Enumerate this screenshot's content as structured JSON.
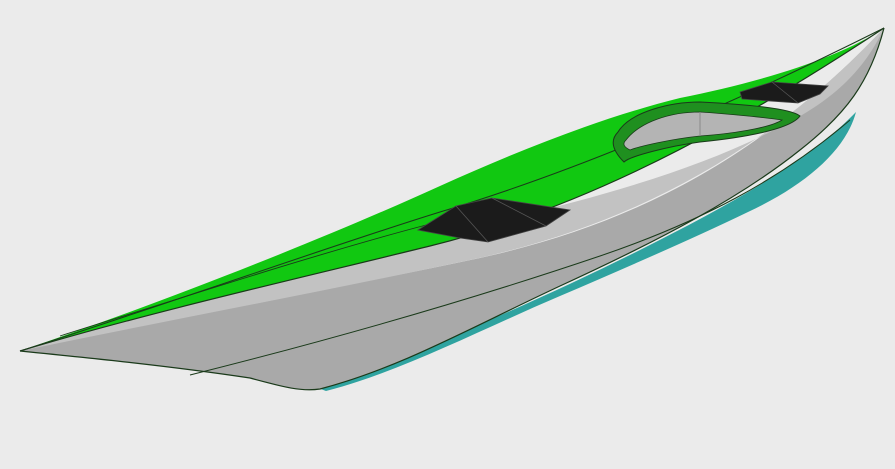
{
  "scene": {
    "subject": "kayak-3d-model",
    "background_color": "#ebebeb",
    "colors": {
      "deck": "#11c811",
      "deck_dark": "#0aa50a",
      "hull": "#a9a9a9",
      "hull_light": "#c2c2c2",
      "hull_shadow": "#8f8f8f",
      "keel": "#2fa3a0",
      "keel_dark": "#1f7f7d",
      "coaming": "#1f8f1f",
      "coaming_light": "#35b835",
      "cockpit_floor": "#b4b4b4",
      "hatch": "#1b1b1b",
      "outline": "#1a3a1a"
    },
    "parts": [
      "bow",
      "stern",
      "deck",
      "hull",
      "cockpit-coaming",
      "front-hatch",
      "rear-hatch",
      "keel-strip"
    ]
  }
}
